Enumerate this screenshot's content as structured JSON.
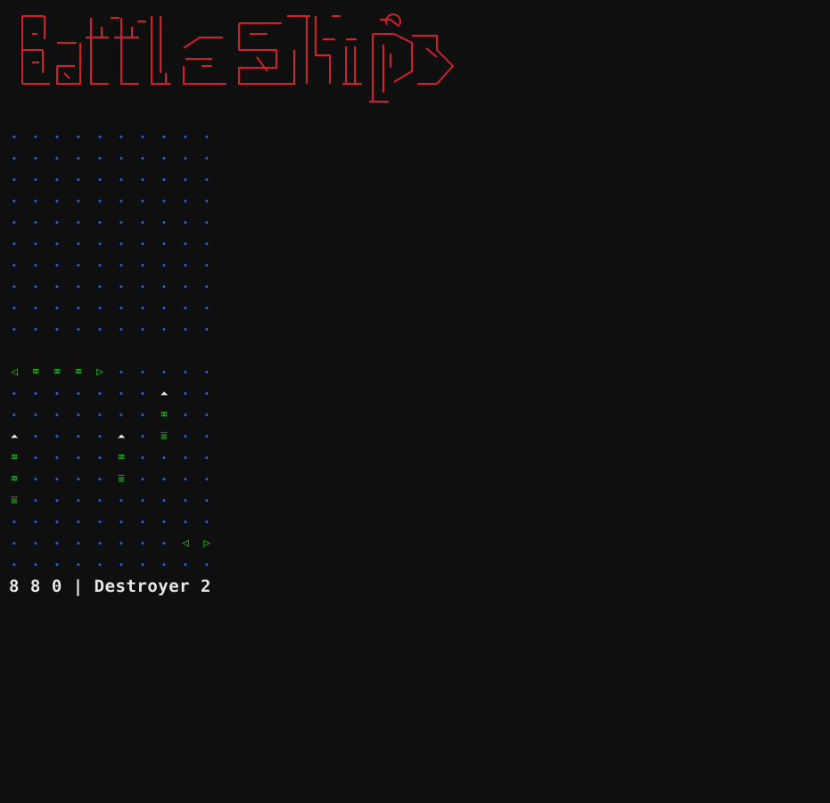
{
  "title_banner": {
    "text": "BattleShip",
    "color": "#d41f2a"
  },
  "enemy_board": {
    "size": [
      10,
      10
    ],
    "cells": [
      "..........",
      "..........",
      "..........",
      "..........",
      "..........",
      "..........",
      "..........",
      "..........",
      "..........",
      ".........."
    ]
  },
  "player_board": {
    "size": [
      10,
      10
    ],
    "cells": [
      "<###>.....",
      ".......^..",
      ".......#..",
      "^....^.v..",
      "#....#....",
      "#....v....",
      "v.........",
      "..........",
      "........<>",
      ".........."
    ],
    "ship_color": "#23c323",
    "water_color": "#2a5fd0"
  },
  "glyphs": {
    ".": "·",
    "#": "⌧",
    "<": "◁",
    ">": "▷",
    "^": "⏶",
    "v": "⩸"
  },
  "status": {
    "values": [
      "8",
      "8",
      "0"
    ],
    "separator": "|",
    "ship_name": "Destroyer",
    "ship_count": "2"
  }
}
